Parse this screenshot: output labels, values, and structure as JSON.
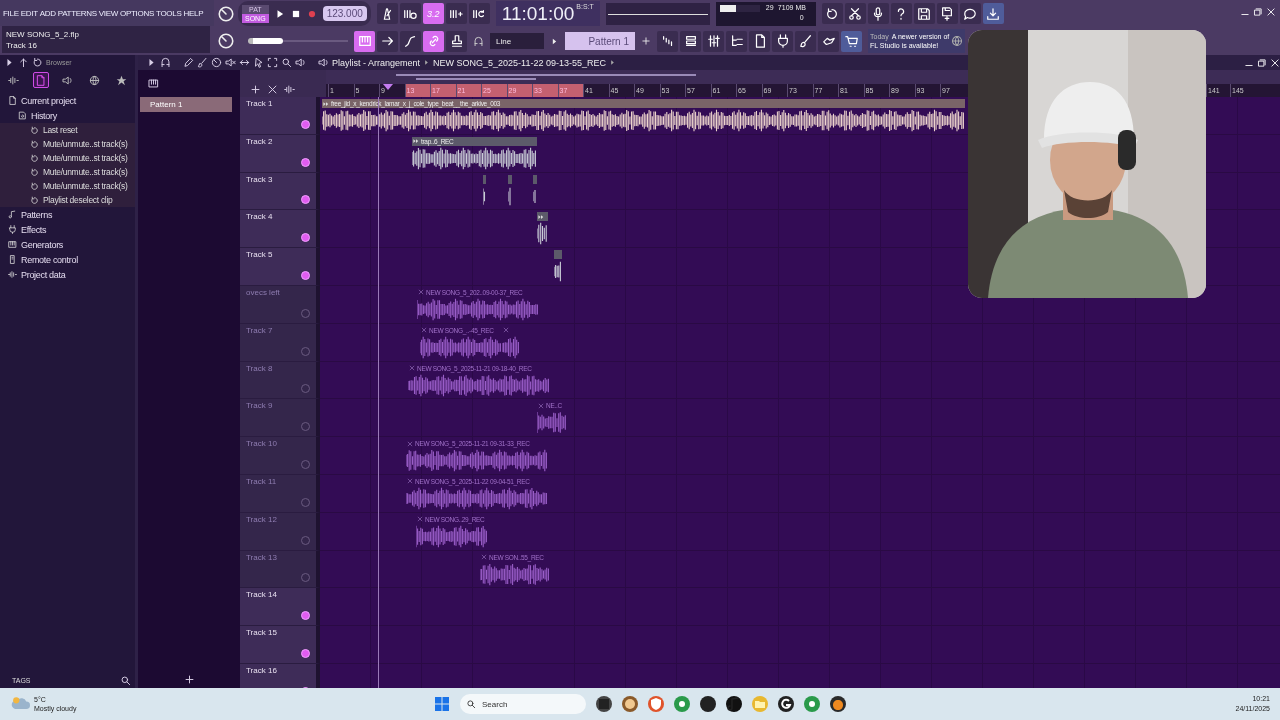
{
  "menu": [
    "FILE",
    "EDIT",
    "ADD",
    "PATTERNS",
    "VIEW",
    "OPTIONS",
    "TOOLS",
    "HELP"
  ],
  "song": {
    "file": "NEW SONG_5_2.flp",
    "hint": "Track 16"
  },
  "mode": [
    {
      "label": "PAT",
      "selected": false
    },
    {
      "label": "SONG",
      "selected": true
    }
  ],
  "tempo": "123.000",
  "time": {
    "value": "11:01:00",
    "unit": "B:S:T"
  },
  "cpu": {
    "polyphony": "29",
    "memory": "7109 MB",
    "voices": "0",
    "level": 0.4
  },
  "master_volume": {
    "level": 0.3
  },
  "toolbar_top": [
    {
      "kind": "metronome",
      "on": false
    },
    {
      "kind": "wait",
      "on": false
    },
    {
      "kind": "countdown",
      "label": "3.2",
      "on": true
    },
    {
      "kind": "step",
      "on": false
    },
    {
      "kind": "loop",
      "on": false
    }
  ],
  "toolbar_right": [
    {
      "kind": "undo",
      "on": false
    },
    {
      "kind": "cut",
      "on": false
    },
    {
      "kind": "mic",
      "on": false
    },
    {
      "kind": "help",
      "on": false
    },
    {
      "kind": "save",
      "on": false
    },
    {
      "kind": "save-new",
      "on": false
    },
    {
      "kind": "chat",
      "on": false
    },
    {
      "kind": "download",
      "on": true
    }
  ],
  "tools": [
    {
      "kind": "piano",
      "on": true
    },
    {
      "kind": "arrow",
      "on": false
    },
    {
      "kind": "curve",
      "on": false
    },
    {
      "kind": "link",
      "on": true
    },
    {
      "kind": "stamp",
      "on": false
    }
  ],
  "snap": "Line",
  "pattern": "Pattern 1",
  "view_buttons": [
    {
      "kind": "steps",
      "on": false
    },
    {
      "kind": "list",
      "on": false
    },
    {
      "kind": "mixer",
      "on": false
    },
    {
      "kind": "tree",
      "on": false
    },
    {
      "kind": "document",
      "on": false
    },
    {
      "kind": "plug",
      "on": false
    },
    {
      "kind": "brush",
      "on": false
    },
    {
      "kind": "hand",
      "on": false
    },
    {
      "kind": "cart",
      "on": true
    }
  ],
  "news": {
    "when": "Today",
    "text": "A newer version of FL Studio is available!"
  },
  "browser": {
    "title": "Browser",
    "tabs": [
      {
        "kind": "waveform",
        "selected": false
      },
      {
        "kind": "document",
        "selected": true
      },
      {
        "kind": "speaker",
        "selected": false
      },
      {
        "kind": "globe",
        "selected": false
      },
      {
        "kind": "star",
        "selected": false
      }
    ],
    "tree": [
      {
        "label": "Current project",
        "kind": "document",
        "children": [
          {
            "label": "History",
            "kind": "history",
            "children": [
              {
                "label": "Last reset",
                "kind": "undo"
              },
              {
                "label": "Mute/unmute..st track(s)",
                "kind": "undo"
              },
              {
                "label": "Mute/unmute..st track(s)",
                "kind": "undo"
              },
              {
                "label": "Mute/unmute..st track(s)",
                "kind": "undo"
              },
              {
                "label": "Mute/unmute..st track(s)",
                "kind": "undo"
              },
              {
                "label": "Playlist deselect clip",
                "kind": "undo"
              }
            ]
          }
        ]
      },
      {
        "label": "Patterns",
        "kind": "note"
      },
      {
        "label": "Effects",
        "kind": "plug"
      },
      {
        "label": "Generators",
        "kind": "piano"
      },
      {
        "label": "Remote control",
        "kind": "remote"
      },
      {
        "label": "Project data",
        "kind": "waveform"
      }
    ],
    "footer": "TAGS"
  },
  "patterns": [
    {
      "label": "Pattern 1",
      "selected": true
    }
  ],
  "playlist": {
    "title": "Playlist - Arrangement",
    "source": "NEW SONG_5_2025-11-22 09-13-55_REC",
    "ruler": [
      {
        "label": "1",
        "in_loop": false
      },
      {
        "label": "5",
        "in_loop": false
      },
      {
        "label": "9",
        "in_loop": false
      },
      {
        "label": "13",
        "in_loop": true
      },
      {
        "label": "17",
        "in_loop": true
      },
      {
        "label": "21",
        "in_loop": true
      },
      {
        "label": "25",
        "in_loop": true
      },
      {
        "label": "29",
        "in_loop": true
      },
      {
        "label": "33",
        "in_loop": true
      },
      {
        "label": "37",
        "in_loop": true
      },
      {
        "label": "41",
        "in_loop": false
      },
      {
        "label": "45",
        "in_loop": false
      },
      {
        "label": "49",
        "in_loop": false
      },
      {
        "label": "53",
        "in_loop": false
      },
      {
        "label": "57",
        "in_loop": false
      },
      {
        "label": "61",
        "in_loop": false
      },
      {
        "label": "65",
        "in_loop": false
      },
      {
        "label": "69",
        "in_loop": false
      },
      {
        "label": "73",
        "in_loop": false
      },
      {
        "label": "77",
        "in_loop": false
      },
      {
        "label": "81",
        "in_loop": false
      },
      {
        "label": "85",
        "in_loop": false
      },
      {
        "label": "89",
        "in_loop": false
      },
      {
        "label": "93",
        "in_loop": false
      },
      {
        "label": "97",
        "in_loop": false
      }
    ],
    "ruler_end": [
      "141",
      "145"
    ],
    "tracks": [
      {
        "name": "Track 1",
        "muted": false,
        "clips": [
          {
            "kind": "audio",
            "label": "free_jid_x_kendrick_lamar_x_j_cole_type_beat__the_arkive_003"
          }
        ]
      },
      {
        "name": "Track 2",
        "muted": false,
        "clips": [
          {
            "kind": "audio",
            "label": "trap..6_REC"
          }
        ]
      },
      {
        "name": "Track 3",
        "muted": false,
        "clips": [
          {
            "kind": "audio"
          },
          {
            "kind": "audio"
          },
          {
            "kind": "audio"
          }
        ]
      },
      {
        "name": "Track 4",
        "muted": false,
        "clips": [
          {
            "kind": "audio"
          }
        ]
      },
      {
        "name": "Track 5",
        "muted": false,
        "clips": [
          {
            "kind": "audio"
          }
        ]
      },
      {
        "name": "ovecs left",
        "muted": true,
        "clips": [
          {
            "kind": "audio",
            "label": "NEW SONG_5_202..09-00-37_REC"
          }
        ]
      },
      {
        "name": "Track 7",
        "muted": true,
        "clips": [
          {
            "kind": "audio",
            "label": "NEW SONG_..-45_REC"
          },
          {
            "kind": "audio"
          }
        ]
      },
      {
        "name": "Track 8",
        "muted": true,
        "clips": [
          {
            "kind": "audio",
            "label": "NEW SONG_5_2025-11-21 09-18-40_REC"
          }
        ]
      },
      {
        "name": "Track 9",
        "muted": true,
        "clips": [
          {
            "kind": "audio",
            "label": "NE..C"
          }
        ]
      },
      {
        "name": "Track 10",
        "muted": true,
        "clips": [
          {
            "kind": "audio",
            "label": "NEW SONG_5_2025-11-21 09-31-33_REC"
          }
        ]
      },
      {
        "name": "Track 11",
        "muted": true,
        "clips": [
          {
            "kind": "audio",
            "label": "NEW SONG_5_2025-11-22 09-04-51_REC"
          }
        ]
      },
      {
        "name": "Track 12",
        "muted": true,
        "clips": [
          {
            "kind": "audio",
            "label": "NEW SONG..29_REC"
          }
        ]
      },
      {
        "name": "Track 13",
        "muted": true,
        "clips": [
          {
            "kind": "audio",
            "label": "NEW SON..55_REC"
          }
        ]
      },
      {
        "name": "Track 14",
        "muted": false
      },
      {
        "name": "Track 15",
        "muted": false
      },
      {
        "name": "Track 16",
        "muted": false
      }
    ]
  },
  "taskbar": {
    "temperature": "5°C",
    "weather": "Mostly cloudy",
    "search": "Search",
    "clock": "10:21",
    "date": "24/11/2025",
    "apps": [
      {
        "kind": "files",
        "color": "#444444"
      },
      {
        "kind": "avatar",
        "color": "#8a5a2a"
      },
      {
        "kind": "shield",
        "color": "#e0532a"
      },
      {
        "kind": "browser",
        "color": "#2a9a4a"
      },
      {
        "kind": "record",
        "color": "#222222"
      },
      {
        "kind": "note",
        "color": "#111111"
      },
      {
        "kind": "folder",
        "color": "#e8b830"
      },
      {
        "kind": "ring",
        "color": "#222222"
      },
      {
        "kind": "browser",
        "color": "#2a9a4a"
      },
      {
        "kind": "fruit",
        "color": "#2a2a2a"
      }
    ]
  }
}
